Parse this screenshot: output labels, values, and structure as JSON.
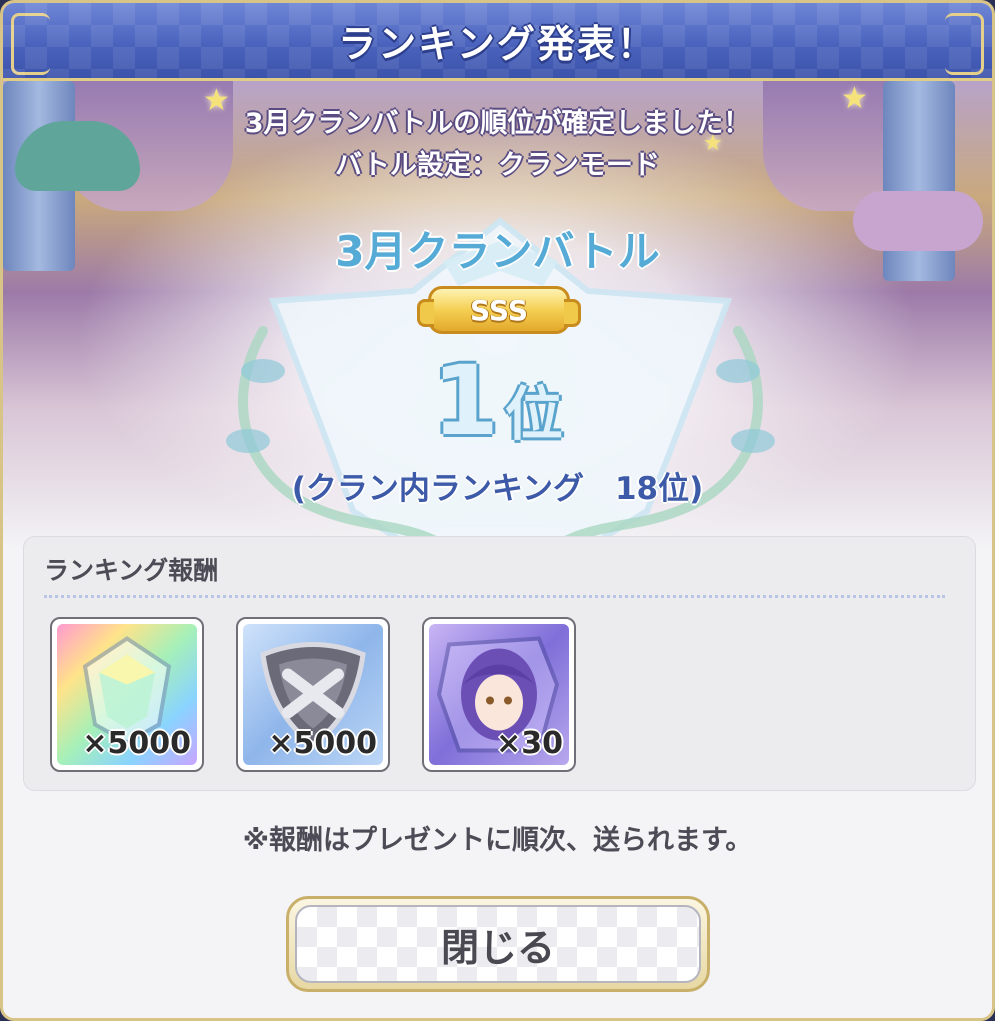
{
  "header": {
    "title": "ランキング発表！"
  },
  "banner": {
    "line1": "3月クランバトルの順位が確定しました！",
    "line2": "バトル設定：クランモード",
    "battle_name": "3月クランバトル",
    "rank_grade": "SSS",
    "rank_number": "1",
    "rank_unit": "位",
    "clan_rank": "(クラン内ランキング　18位)"
  },
  "rewards": {
    "title": "ランキング報酬",
    "items": [
      {
        "icon": "rainbow-jewel-icon",
        "count": "×5000"
      },
      {
        "icon": "clan-coin-shield-icon",
        "count": "×5000"
      },
      {
        "icon": "character-memory-piece-icon",
        "count": "×30"
      }
    ]
  },
  "note": "※報酬はプレゼントに順次、送られます。",
  "close_button": {
    "label": "閉じる"
  },
  "colors": {
    "header": "#4a63bd",
    "gold_border": "#d8c486",
    "rank_badge": "#f4cf52",
    "battle_name": "#55aad6"
  }
}
